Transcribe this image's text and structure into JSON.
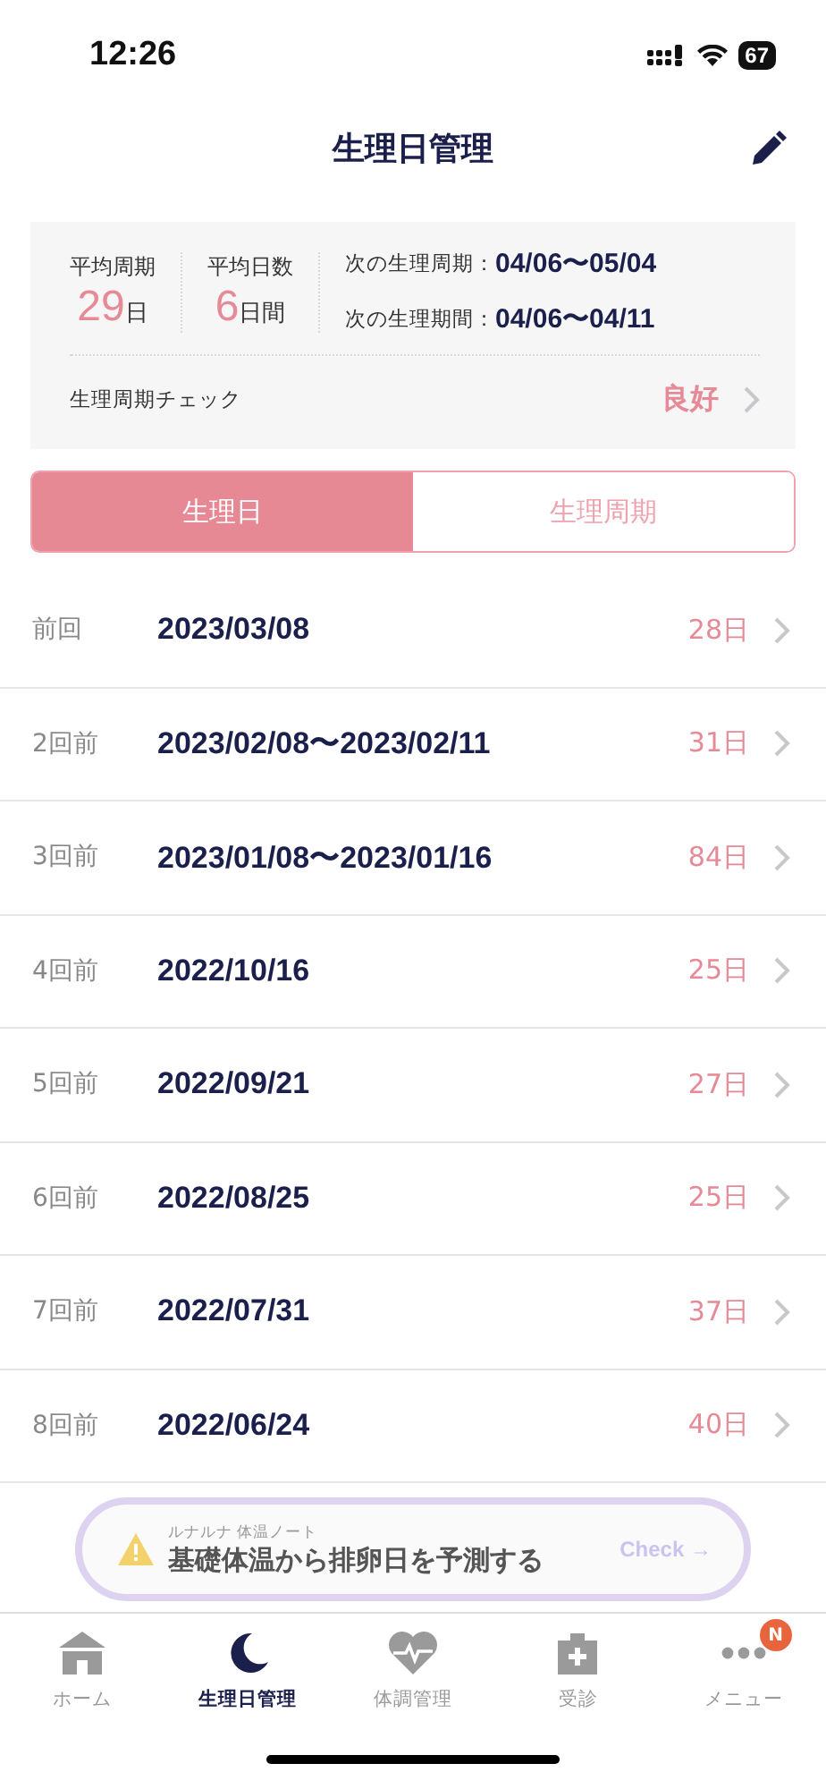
{
  "status_bar": {
    "time": "12:26",
    "battery": "67"
  },
  "header": {
    "title": "生理日管理"
  },
  "summary": {
    "avg_cycle": {
      "label": "平均周期",
      "value": "29",
      "unit": "日"
    },
    "avg_days": {
      "label": "平均日数",
      "value": "6",
      "unit": "日間"
    },
    "next": [
      {
        "label": "次の生理周期：",
        "value": "04/06〜05/04"
      },
      {
        "label": "次の生理期間：",
        "value": "04/06〜04/11"
      }
    ],
    "check": {
      "label": "生理周期チェック",
      "value": "良好"
    }
  },
  "tabs": [
    {
      "label": "生理日",
      "selected": true
    },
    {
      "label": "生理周期",
      "selected": false
    }
  ],
  "rows": [
    {
      "when": "前回",
      "date": "2023/03/08",
      "days": "28日"
    },
    {
      "when": "2回前",
      "date": "2023/02/08〜2023/02/11",
      "days": "31日"
    },
    {
      "when": "3回前",
      "date": "2023/01/08〜2023/01/16",
      "days": "84日"
    },
    {
      "when": "4回前",
      "date": "2022/10/16",
      "days": "25日"
    },
    {
      "when": "5回前",
      "date": "2022/09/21",
      "days": "27日"
    },
    {
      "when": "6回前",
      "date": "2022/08/25",
      "days": "25日"
    },
    {
      "when": "7回前",
      "date": "2022/07/31",
      "days": "37日"
    },
    {
      "when": "8回前",
      "date": "2022/06/24",
      "days": "40日"
    }
  ],
  "banner": {
    "caption": "ルナルナ 体温ノート",
    "text": "基礎体温から排卵日を予測する",
    "action": "Check →"
  },
  "nav": [
    {
      "kind": "home",
      "label": "ホーム",
      "selected": false
    },
    {
      "kind": "moon",
      "label": "生理日管理",
      "selected": true
    },
    {
      "kind": "heart",
      "label": "体調管理",
      "selected": false
    },
    {
      "kind": "clinic",
      "label": "受診",
      "selected": false
    },
    {
      "kind": "menu",
      "label": "メニュー",
      "selected": false,
      "badge": "N"
    }
  ]
}
